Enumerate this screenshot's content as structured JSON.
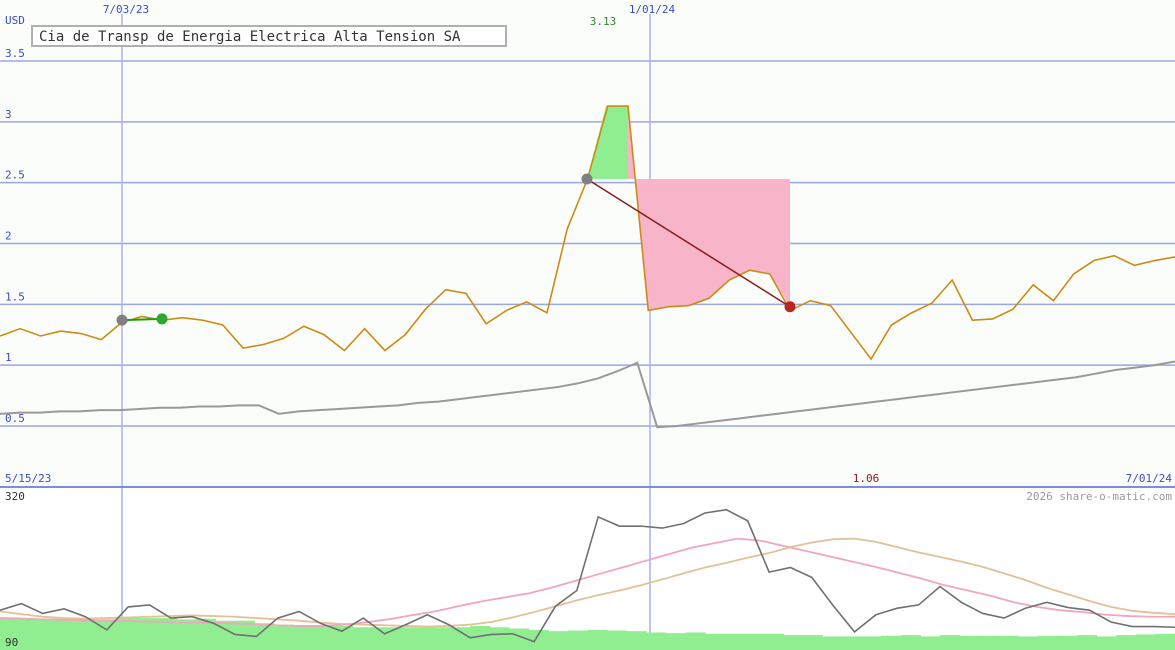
{
  "chart_data": [
    {
      "type": "line",
      "title": "Cia de Transp de Energia Electrica Alta Tension SA",
      "ylabel": "USD",
      "ylim": [
        0.5,
        3.5
      ],
      "yticks": [
        "3.5",
        "3",
        "2.5",
        "2",
        "1.5",
        "1",
        "0.5"
      ],
      "grid": true,
      "date_labels_top": [
        "7/03/23",
        "1/01/24"
      ],
      "date_labels_bottom": [
        "5/15/23",
        "7/01/24"
      ],
      "annotations": {
        "peak": "3.13",
        "low": "1.06"
      },
      "series": [
        {
          "values": [
            1.24,
            1.3,
            1.24,
            1.28,
            1.26,
            1.21,
            1.35,
            1.4,
            1.37,
            1.39,
            1.37,
            1.33,
            1.14,
            1.17,
            1.22,
            1.32,
            1.25,
            1.12,
            1.3,
            1.12,
            1.25,
            1.46,
            1.62,
            1.59,
            1.34,
            1.45,
            1.52,
            1.43,
            2.12,
            2.53,
            3.13,
            3.13,
            1.45,
            1.48,
            1.49,
            1.55,
            1.7,
            1.78,
            1.75,
            1.45,
            1.53,
            1.49,
            1.27,
            1.05,
            1.33,
            1.43,
            1.51,
            1.7,
            1.37,
            1.38,
            1.46,
            1.66,
            1.53,
            1.75,
            1.86,
            1.9,
            1.82,
            1.86,
            1.89
          ],
          "color": "#cc8b14"
        },
        {
          "values": [
            0.6,
            0.61,
            0.61,
            0.62,
            0.62,
            0.63,
            0.63,
            0.64,
            0.65,
            0.65,
            0.66,
            0.66,
            0.67,
            0.67,
            0.6,
            0.62,
            0.63,
            0.64,
            0.65,
            0.66,
            0.67,
            0.69,
            0.7,
            0.72,
            0.74,
            0.76,
            0.78,
            0.8,
            0.82,
            0.85,
            0.89,
            0.95,
            1.02,
            0.49,
            0.5,
            0.52,
            0.54,
            0.56,
            0.58,
            0.6,
            0.62,
            0.64,
            0.66,
            0.68,
            0.7,
            0.72,
            0.74,
            0.76,
            0.78,
            0.8,
            0.82,
            0.84,
            0.86,
            0.88,
            0.9,
            0.93,
            0.96,
            0.98,
            1.0,
            1.03
          ],
          "color": "#999999"
        }
      ],
      "trades": [
        {
          "entry": 1.37,
          "exit": 1.38,
          "result": "gain"
        },
        {
          "entry": 2.53,
          "exit": 3.13,
          "result": "gain"
        },
        {
          "entry": 2.53,
          "exit": 1.48,
          "result": "loss"
        }
      ]
    },
    {
      "type": "line",
      "ylim": [
        90,
        320
      ],
      "yticks": [
        "320",
        "90"
      ],
      "watermark": "2026 share-o-matic.com",
      "series": [
        {
          "values": [
            140,
            150,
            135,
            142,
            130,
            110,
            145,
            148,
            128,
            130,
            120,
            103,
            100,
            128,
            138,
            120,
            108,
            128,
            104,
            118,
            133,
            118,
            98,
            103,
            104,
            92,
            146,
            170,
            282,
            268,
            268,
            265,
            272,
            288,
            293,
            276,
            198,
            205,
            190,
            147,
            107,
            133,
            143,
            148,
            176,
            152,
            135,
            128,
            143,
            152,
            144,
            140,
            122,
            115,
            115,
            114
          ],
          "color": "#707070"
        },
        {
          "values": [
            128,
            127,
            126,
            125,
            124,
            124,
            123,
            122,
            121,
            121,
            120,
            119,
            117,
            116,
            116,
            118,
            122,
            127,
            133,
            139,
            147,
            154,
            160,
            166,
            175,
            185,
            195,
            205,
            215,
            225,
            235,
            242,
            249,
            246,
            238,
            230,
            222,
            214,
            206,
            197,
            188,
            178,
            170,
            162,
            152,
            145,
            140,
            137,
            133,
            131,
            130,
            130
          ],
          "color": "#f0a6bc"
        },
        {
          "values": [
            138,
            134,
            130,
            128,
            127,
            128,
            129,
            130,
            131,
            132,
            131,
            130,
            128,
            126,
            124,
            121,
            119,
            118,
            117,
            116,
            115,
            116,
            118,
            122,
            129,
            137,
            146,
            155,
            163,
            170,
            178,
            187,
            196,
            205,
            212,
            220,
            227,
            236,
            243,
            248,
            249,
            244,
            236,
            228,
            221,
            214,
            206,
            196,
            186,
            174,
            164,
            154,
            145,
            139,
            136,
            134
          ],
          "color": "#e4c096"
        },
        {
          "values": [
            129,
            127,
            127,
            125,
            126,
            126,
            128,
            128,
            128,
            126,
            127,
            124,
            124,
            120,
            118,
            116,
            116,
            116,
            114,
            114,
            114,
            114,
            114,
            114,
            116,
            114,
            112,
            110,
            108,
            109,
            110,
            109,
            108,
            106,
            105,
            106,
            104,
            104,
            104,
            104,
            102,
            102,
            100,
            100,
            100,
            101,
            102,
            100,
            102,
            101,
            101,
            101,
            100,
            101,
            101,
            102,
            100,
            102,
            103,
            104
          ],
          "color": "#90ee90",
          "fill": true
        }
      ]
    }
  ]
}
